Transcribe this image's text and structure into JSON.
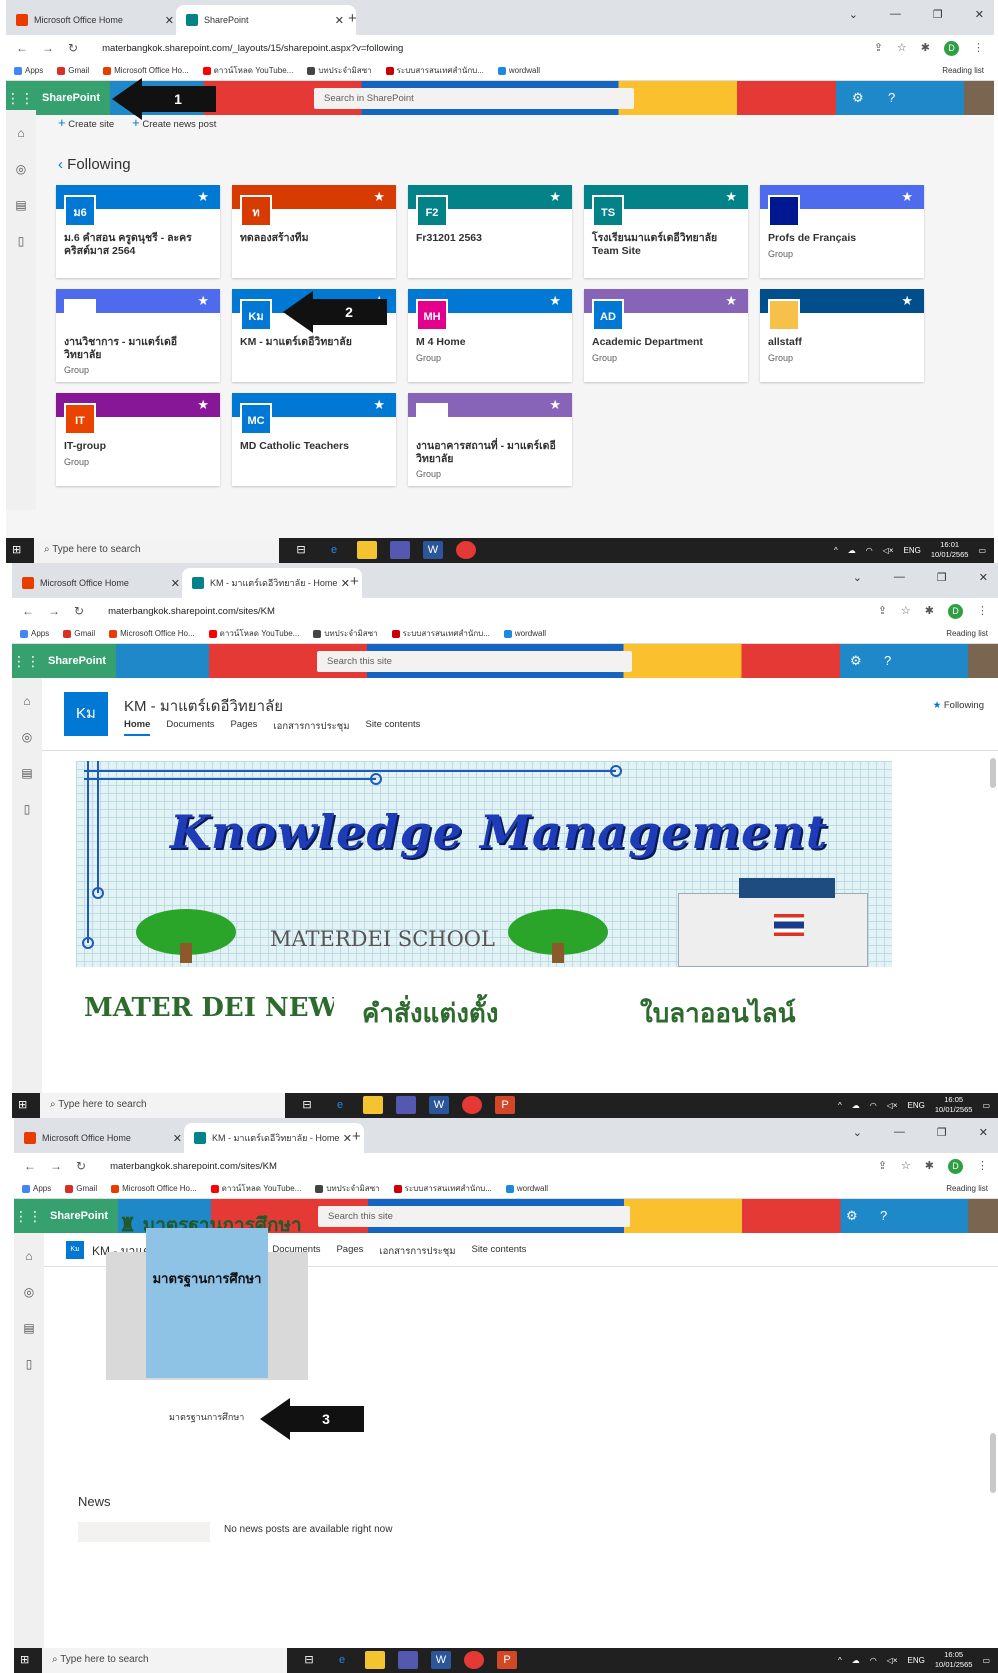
{
  "s1": {
    "tabs": [
      "Microsoft Office Home",
      "SharePoint"
    ],
    "url": "materbangkok.sharepoint.com/_layouts/15/sharepoint.aspx?v=following",
    "bookmarks": [
      "Apps",
      "Gmail",
      "Microsoft Office Ho...",
      "ดาวน์โหลด YouTube...",
      "บทประจำมิสซา",
      "ระบบสารสนเทศสำนักบ...",
      "wordwall"
    ],
    "reading_list": "Reading list",
    "brand": "SharePoint",
    "search_placeholder": "Search in SharePoint",
    "create_site": "Create site",
    "create_news": "Create news post",
    "following_title": "Following",
    "arrow1": "1",
    "arrow2": "2",
    "cards": [
      {
        "logo": "ม6",
        "name": "ม.6 คำสอน ครูดนุชรี - ละคร คริสต์มาส 2564",
        "sub": "",
        "bar": "#0078d4",
        "logo_bg": "#0078d4"
      },
      {
        "logo": "ท",
        "name": "ทดลองสร้างทีม",
        "sub": "",
        "bar": "#d83b01",
        "logo_bg": "#d83b01"
      },
      {
        "logo": "F2",
        "name": "Fr31201 2563",
        "sub": "",
        "bar": "#038387",
        "logo_bg": "#038387"
      },
      {
        "logo": "TS",
        "name": "โรงเรียนมาแตร์เดอีวิทยาลัย Team Site",
        "sub": "",
        "bar": "#038387",
        "logo_bg": "#038387"
      },
      {
        "logo": "",
        "name": "Profs de Français",
        "sub": "Group",
        "bar": "#4f6bed",
        "logo_bg": "#00188f"
      },
      {
        "logo": "",
        "name": "งานวิชาการ - มาแตร์เดอีวิทยาลัย",
        "sub": "Group",
        "bar": "#4f6bed",
        "logo_bg": "#ffffff"
      },
      {
        "logo": "Kม",
        "name": "KM - มาแตร์เดอีวิทยาลัย",
        "sub": "",
        "bar": "#0078d4",
        "logo_bg": "#0078d4"
      },
      {
        "logo": "MH",
        "name": "M 4 Home",
        "sub": "Group",
        "bar": "#0078d4",
        "logo_bg": "#e3008c"
      },
      {
        "logo": "AD",
        "name": "Academic Department",
        "sub": "Group",
        "bar": "#8764b8",
        "logo_bg": "#0078d4"
      },
      {
        "logo": "",
        "name": "allstaff",
        "sub": "Group",
        "bar": "#004e8c",
        "logo_bg": "#f7c04a"
      },
      {
        "logo": "IT",
        "name": "IT-group",
        "sub": "Group",
        "bar": "#881798",
        "logo_bg": "#ea4300"
      },
      {
        "logo": "MC",
        "name": "MD Catholic Teachers",
        "sub": "",
        "bar": "#0078d4",
        "logo_bg": "#0078d4"
      },
      {
        "logo": "",
        "name": "งานอาคารสถานที่ - มาแตร์เดอีวิทยาลัย",
        "sub": "Group",
        "bar": "#8764b8",
        "logo_bg": "#ffffff"
      }
    ],
    "taskbar_search": "Type here to search",
    "time": "16:01",
    "date": "10/01/2565",
    "lang": "ENG"
  },
  "s2": {
    "tabs": [
      "Microsoft Office Home",
      "KM - มาแตร์เดอีวิทยาลัย - Home"
    ],
    "url": "materbangkok.sharepoint.com/sites/KM",
    "search_placeholder": "Search this site",
    "site_logo": "Kม",
    "site_title": "KM - มาแตร์เดอีวิทยาลัย",
    "nav": [
      "Home",
      "Documents",
      "Pages",
      "เอกสารการประชุม",
      "Site contents"
    ],
    "following": "Following",
    "banner_title": "Knowledge Management",
    "banner_school": "MATERDEI SCHOOL",
    "tiles": [
      "MATER DEI NEWS",
      "คำสั่งแต่งตั้ง",
      "ใบลาออนไลน์"
    ],
    "time": "16:05",
    "date": "10/01/2565"
  },
  "s3": {
    "url": "materbangkok.sharepoint.com/sites/KM",
    "site_title": "KM - มาแตร์เดอีวิทยาลัย",
    "standards_heading": "มาตรฐานการศึกษา",
    "book_title": "มาตรฐานการศึกษา",
    "caption": "มาตรฐานการศึกษา",
    "arrow3": "3",
    "news": "News",
    "no_news": "No news posts are available right now",
    "time": "16:05",
    "date": "10/01/2565"
  }
}
